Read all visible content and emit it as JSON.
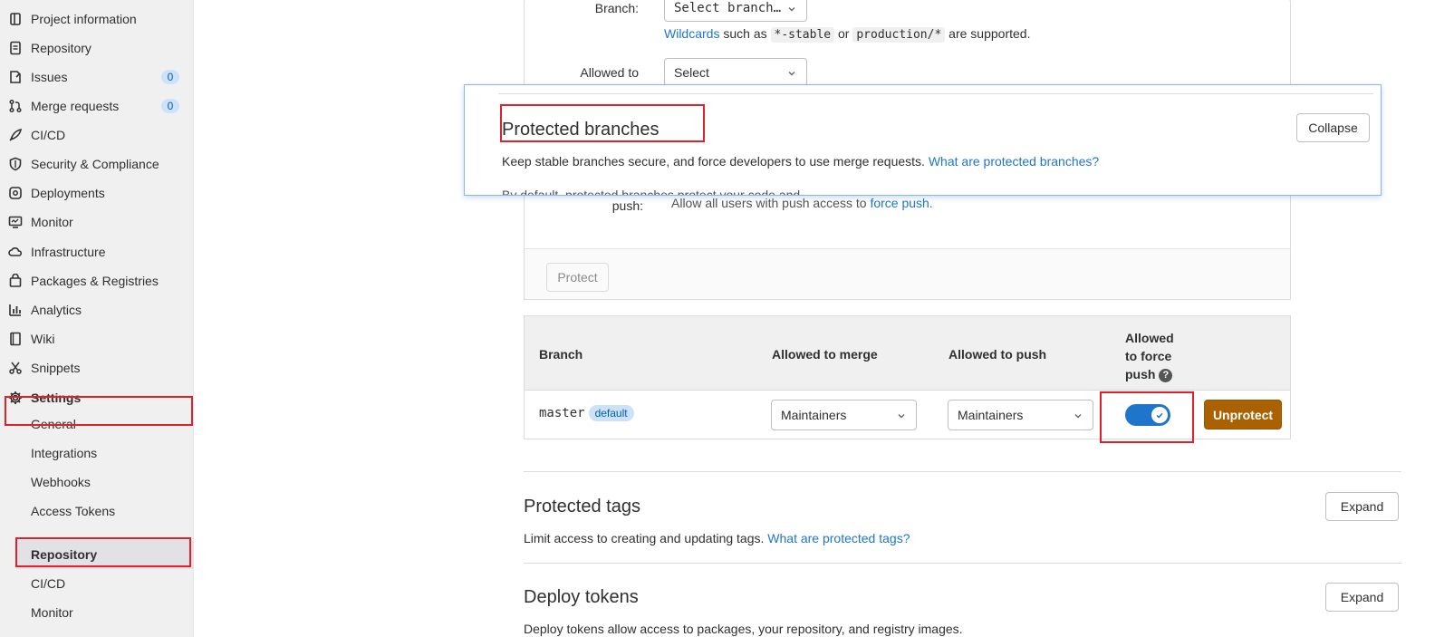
{
  "sidebar": {
    "items": [
      {
        "label": "Project information",
        "icon": "project-info-icon"
      },
      {
        "label": "Repository",
        "icon": "repository-doc-icon"
      },
      {
        "label": "Issues",
        "icon": "issues-icon",
        "count": "0"
      },
      {
        "label": "Merge requests",
        "icon": "merge-request-icon",
        "count": "0"
      },
      {
        "label": "CI/CD",
        "icon": "rocket-icon"
      },
      {
        "label": "Security & Compliance",
        "icon": "shield-icon"
      },
      {
        "label": "Deployments",
        "icon": "deployments-icon"
      },
      {
        "label": "Monitor",
        "icon": "monitor-icon"
      },
      {
        "label": "Infrastructure",
        "icon": "cloud-icon"
      },
      {
        "label": "Packages & Registries",
        "icon": "package-icon"
      },
      {
        "label": "Analytics",
        "icon": "chart-icon"
      },
      {
        "label": "Wiki",
        "icon": "book-icon"
      },
      {
        "label": "Snippets",
        "icon": "scissors-icon"
      },
      {
        "label": "Settings",
        "icon": "gear-icon"
      }
    ],
    "settings_sub": [
      "General",
      "Integrations",
      "Webhooks",
      "Access Tokens",
      "Repository",
      "CI/CD",
      "Monitor"
    ]
  },
  "form": {
    "branch_label": "Branch:",
    "branch_placeholder": "Select branch…",
    "wildcards_link": "Wildcards",
    "hint_middle": "such as",
    "code_stable": "*-stable",
    "hint_or": "or",
    "code_production": "production/*",
    "hint_end": "are supported.",
    "allowed_to_label": "Allowed to",
    "allowed_select": "Select",
    "push_label": "push:",
    "force_push_text": "Allow all users with push access to",
    "force_push_link": "force push.",
    "protect_button": "Protect"
  },
  "table": {
    "headers": {
      "branch": "Branch",
      "merge": "Allowed to merge",
      "push": "Allowed to push",
      "force_line1": "Allowed",
      "force_line2": "to force",
      "force_line3": "push"
    },
    "row": {
      "branch": "master",
      "badge": "default",
      "merge": "Maintainers",
      "push": "Maintainers",
      "unprotect": "Unprotect"
    }
  },
  "sections": {
    "tags_title": "Protected tags",
    "tags_desc": "Limit access to creating and updating tags.",
    "tags_link": "What are protected tags?",
    "tags_button": "Expand",
    "tokens_title": "Deploy tokens",
    "tokens_desc": "Deploy tokens allow access to packages, your repository, and registry images.",
    "tokens_button": "Expand"
  },
  "popup": {
    "title": "Protected branches",
    "desc": "Keep stable branches secure, and force developers to use merge requests.",
    "link": "What are protected branches?",
    "collapse": "Collapse",
    "cut_text": "By default, protected branches protect your code and"
  },
  "colors": {
    "accent": "#1f75cb",
    "unprotect": "#ab6100",
    "highlight": "#e0202a"
  }
}
